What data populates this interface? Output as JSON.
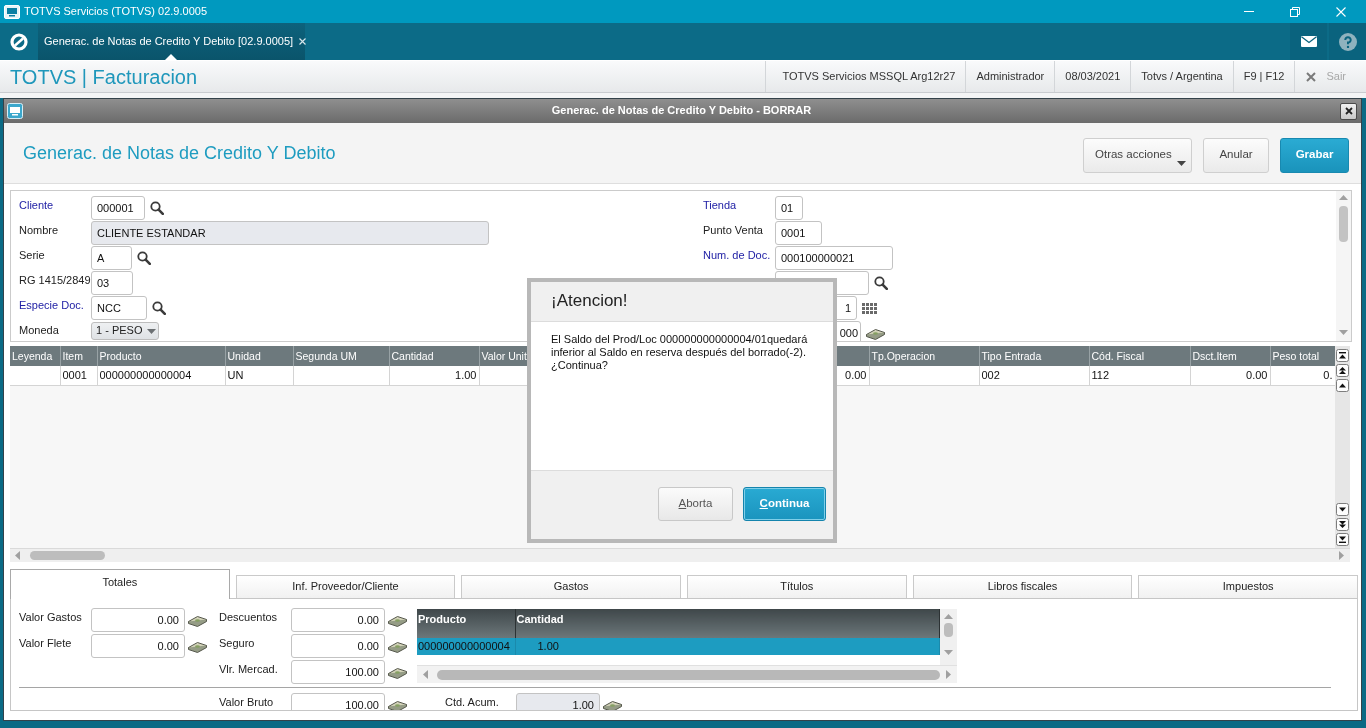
{
  "window": {
    "title": "TOTVS Servicios (TOTVS) 02.9.0005"
  },
  "tab_bar": {
    "tabs": [
      {
        "label": "Generac. de Notas de Credito Y Debito [02.9.0005]",
        "selected": true
      }
    ]
  },
  "app_header": {
    "title": "TOTVS | Facturacion",
    "info": [
      "TOTVS Servicios MSSQL Arg12r27",
      "Administrador",
      "08/03/2021",
      "Totvs / Argentina",
      "F9 | F12"
    ],
    "exit": {
      "label": "Sair"
    }
  },
  "form_window": {
    "title": "Generac. de Notas de Credito Y Debito - BORRAR",
    "heading": "Generac. de Notas de Credito Y Debito",
    "actions": [
      {
        "label": "Otras acciones",
        "kind": "menu"
      },
      {
        "label": "Anular",
        "kind": "default"
      },
      {
        "label": "Grabar",
        "kind": "primary"
      }
    ]
  },
  "header_form": {
    "left_fields": [
      {
        "label": "Cliente",
        "required": true,
        "value": "000001",
        "kind": "lookup"
      },
      {
        "label": "Nombre",
        "required": false,
        "value": "CLIENTE ESTANDAR",
        "kind": "readonly"
      },
      {
        "label": "Serie",
        "required": false,
        "value": "A",
        "kind": "lookup"
      },
      {
        "label": "RG 1415/2849",
        "required": false,
        "value": "03",
        "kind": "text"
      },
      {
        "label": "Especie Doc.",
        "required": true,
        "value": "NCC",
        "kind": "lookup"
      },
      {
        "label": "Moneda",
        "required": false,
        "value": "1 - PESO",
        "kind": "select"
      }
    ],
    "right_fields": [
      {
        "label": "Tienda",
        "required": true,
        "value": "01",
        "kind": "text"
      },
      {
        "label": "Punto Venta",
        "required": false,
        "value": "0001",
        "kind": "text"
      },
      {
        "label": "Num. de Doc.",
        "required": true,
        "value": "000100000021",
        "kind": "text"
      },
      {
        "kind": "lookup"
      },
      {
        "value": "1",
        "kind": "date"
      },
      {
        "value": "000",
        "kind": "currency"
      }
    ]
  },
  "grid": {
    "columns": [
      {
        "label": "Leyenda",
        "kind": "text"
      },
      {
        "label": "Item",
        "kind": "text"
      },
      {
        "label": "Producto",
        "kind": "text"
      },
      {
        "label": "Unidad",
        "kind": "text"
      },
      {
        "label": "Segunda UM",
        "kind": "text"
      },
      {
        "label": "Cantidad",
        "kind": "number"
      },
      {
        "label": "Valor Unit",
        "kind": "number"
      },
      {
        "kind": "number"
      },
      {
        "label": "Tp.Operacion",
        "kind": "text"
      },
      {
        "label": "Tipo Entrada",
        "kind": "text"
      },
      {
        "label": "Cód. Fiscal",
        "kind": "text"
      },
      {
        "label": "Dsct.Item",
        "kind": "number"
      },
      {
        "label": "Peso total",
        "kind": "number"
      }
    ],
    "rows": [
      [
        null,
        "0001",
        "000000000000004",
        "UN",
        null,
        "1.00",
        null,
        "0.00",
        null,
        "002",
        "112",
        "0.00",
        "0."
      ]
    ]
  },
  "bottom_tabs": [
    {
      "label": "Totales",
      "selected": true
    },
    {
      "label": "Inf. Proveedor/Cliente",
      "selected": false
    },
    {
      "label": "Gastos",
      "selected": false
    },
    {
      "label": "Títulos",
      "selected": false
    },
    {
      "label": "Libros fiscales",
      "selected": false
    },
    {
      "label": "Impuestos",
      "selected": false
    }
  ],
  "totales": {
    "left_fields": [
      {
        "label": "Valor Gastos",
        "value": "0.00"
      },
      {
        "label": "Valor Flete",
        "value": "0.00"
      }
    ],
    "middle_fields": [
      {
        "label": "Descuentos",
        "value": "0.00"
      },
      {
        "label": "Seguro",
        "value": "0.00"
      },
      {
        "label": "Vlr. Mercad.",
        "value": "100.00"
      }
    ],
    "product_grid": {
      "columns": [
        "Producto",
        "Cantidad"
      ],
      "rows": [
        {
          "cells": [
            "000000000000004",
            "1.00"
          ],
          "selected": true
        }
      ]
    },
    "summary_fields": [
      {
        "label": "Valor Bruto",
        "value": "100.00",
        "readonly": false
      },
      {
        "label": "Ctd. Acum.",
        "value": "1.00",
        "readonly": true
      }
    ]
  },
  "alert": {
    "title": "¡Atencion!",
    "message": [
      "El Saldo del Prod/Loc 000000000000004/01quedará inferior al Saldo en reserva después del borrado(-2).",
      "¿Continua?"
    ],
    "buttons": [
      {
        "label": "Aborta",
        "kind": "default"
      },
      {
        "label": "Continua",
        "kind": "primary"
      }
    ]
  }
}
